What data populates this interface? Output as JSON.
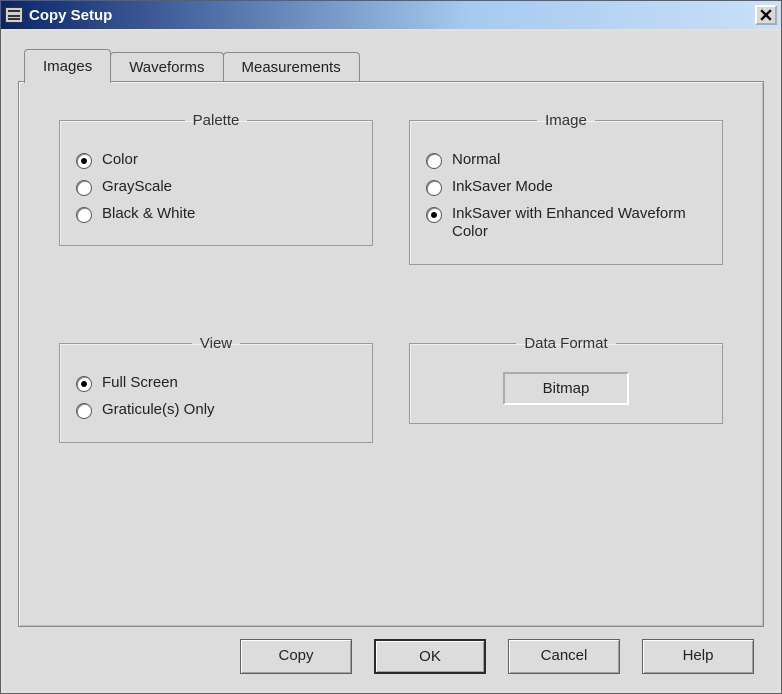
{
  "window": {
    "title": "Copy Setup"
  },
  "tabs": {
    "images": "Images",
    "waveforms": "Waveforms",
    "measurements": "Measurements"
  },
  "groups": {
    "palette": {
      "legend": "Palette",
      "color": "Color",
      "grayscale": "GrayScale",
      "bw": "Black & White"
    },
    "image": {
      "legend": "Image",
      "normal": "Normal",
      "inksaver": "InkSaver Mode",
      "inksaver_enh": "InkSaver with Enhanced Waveform Color"
    },
    "view": {
      "legend": "View",
      "full": "Full Screen",
      "grat": "Graticule(s) Only"
    },
    "dataformat": {
      "legend": "Data Format",
      "value": "Bitmap"
    }
  },
  "buttons": {
    "copy": "Copy",
    "ok": "OK",
    "cancel": "Cancel",
    "help": "Help"
  }
}
